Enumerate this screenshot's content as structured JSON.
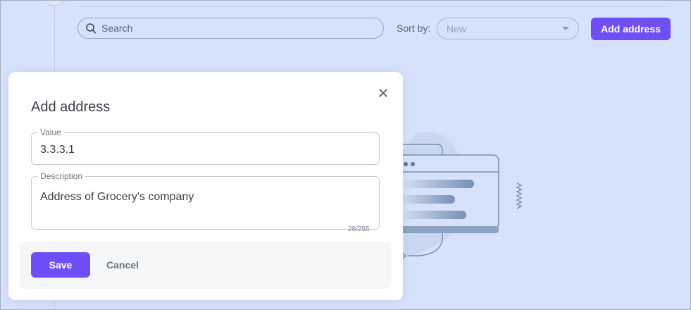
{
  "toolbar": {
    "search_placeholder": "Search",
    "sort_label": "Sort by:",
    "sort_value": "New",
    "add_button_label": "Add address"
  },
  "modal": {
    "title": "Add address",
    "value_field": {
      "label": "Value",
      "value": "3.3.3.1"
    },
    "description_field": {
      "label": "Description",
      "value": "Address of Grocery's company",
      "counter": "28/255"
    },
    "save_label": "Save",
    "cancel_label": "Cancel"
  },
  "colors": {
    "accent": "#6f4ef6",
    "background": "#d6e1fb",
    "modal_bg": "#ffffff"
  },
  "icons": {
    "search": "search-icon",
    "close": "close-icon",
    "dropdown": "chevron-down-icon"
  }
}
